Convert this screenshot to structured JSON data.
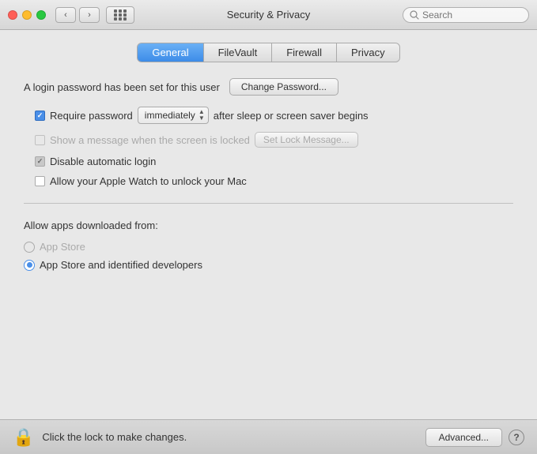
{
  "titlebar": {
    "title": "Security & Privacy",
    "search_placeholder": "Search",
    "back_label": "‹",
    "forward_label": "›"
  },
  "tabs": [
    {
      "id": "general",
      "label": "General",
      "active": true
    },
    {
      "id": "filevault",
      "label": "FileVault",
      "active": false
    },
    {
      "id": "firewall",
      "label": "Firewall",
      "active": false
    },
    {
      "id": "privacy",
      "label": "Privacy",
      "active": false
    }
  ],
  "login_section": {
    "password_label": "A login password has been set for this user",
    "change_button": "Change Password..."
  },
  "options": {
    "require_password": {
      "label": "Require password",
      "checked": true,
      "disabled": false,
      "dropdown_value": "immediately",
      "suffix": "after sleep or screen saver begins"
    },
    "show_message": {
      "label": "Show a message when the screen is locked",
      "checked": false,
      "disabled": true,
      "button": "Set Lock Message..."
    },
    "disable_auto_login": {
      "label": "Disable automatic login",
      "checked": true,
      "disabled": true
    },
    "apple_watch": {
      "label": "Allow your Apple Watch to unlock your Mac",
      "checked": false,
      "disabled": false
    }
  },
  "apps_section": {
    "label": "Allow apps downloaded from:",
    "options": [
      {
        "id": "app-store",
        "label": "App Store",
        "selected": false
      },
      {
        "id": "app-store-identified",
        "label": "App Store and identified developers",
        "selected": true
      }
    ]
  },
  "bottom_bar": {
    "lock_label": "Click the lock to make changes.",
    "advanced_button": "Advanced...",
    "help_label": "?"
  }
}
